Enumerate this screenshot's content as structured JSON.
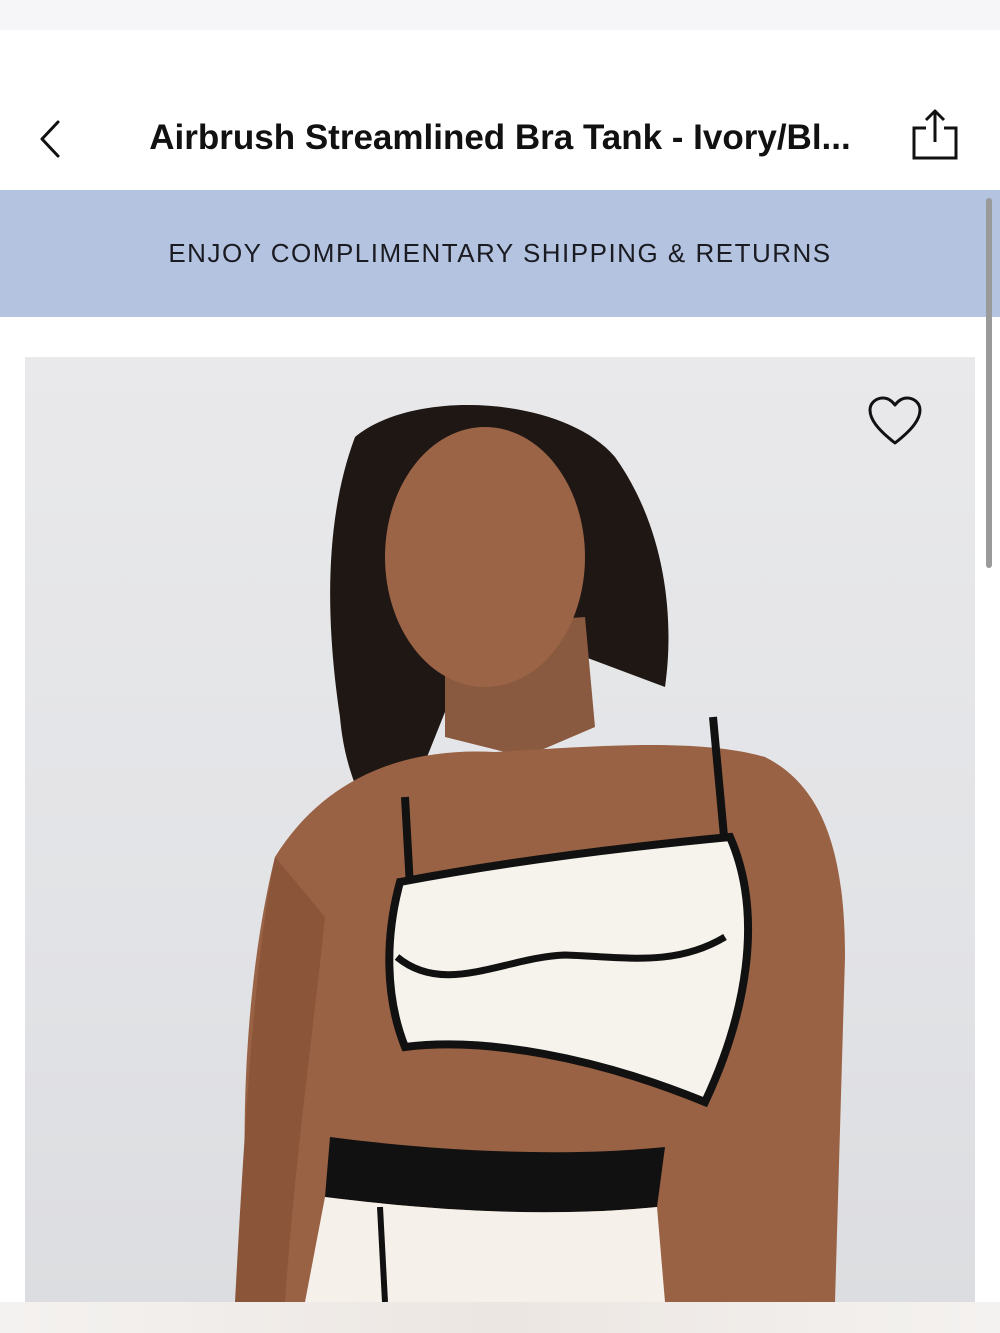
{
  "header": {
    "title": "Airbrush Streamlined Bra Tank - Ivory/Bl...",
    "back_icon": "chevron-left-icon",
    "share_icon": "share-icon"
  },
  "banner": {
    "text": "ENJOY COMPLIMENTARY SHIPPING & RETURNS",
    "background_color": "#b3c3e0"
  },
  "product_image": {
    "wishlist_icon": "heart-icon"
  }
}
